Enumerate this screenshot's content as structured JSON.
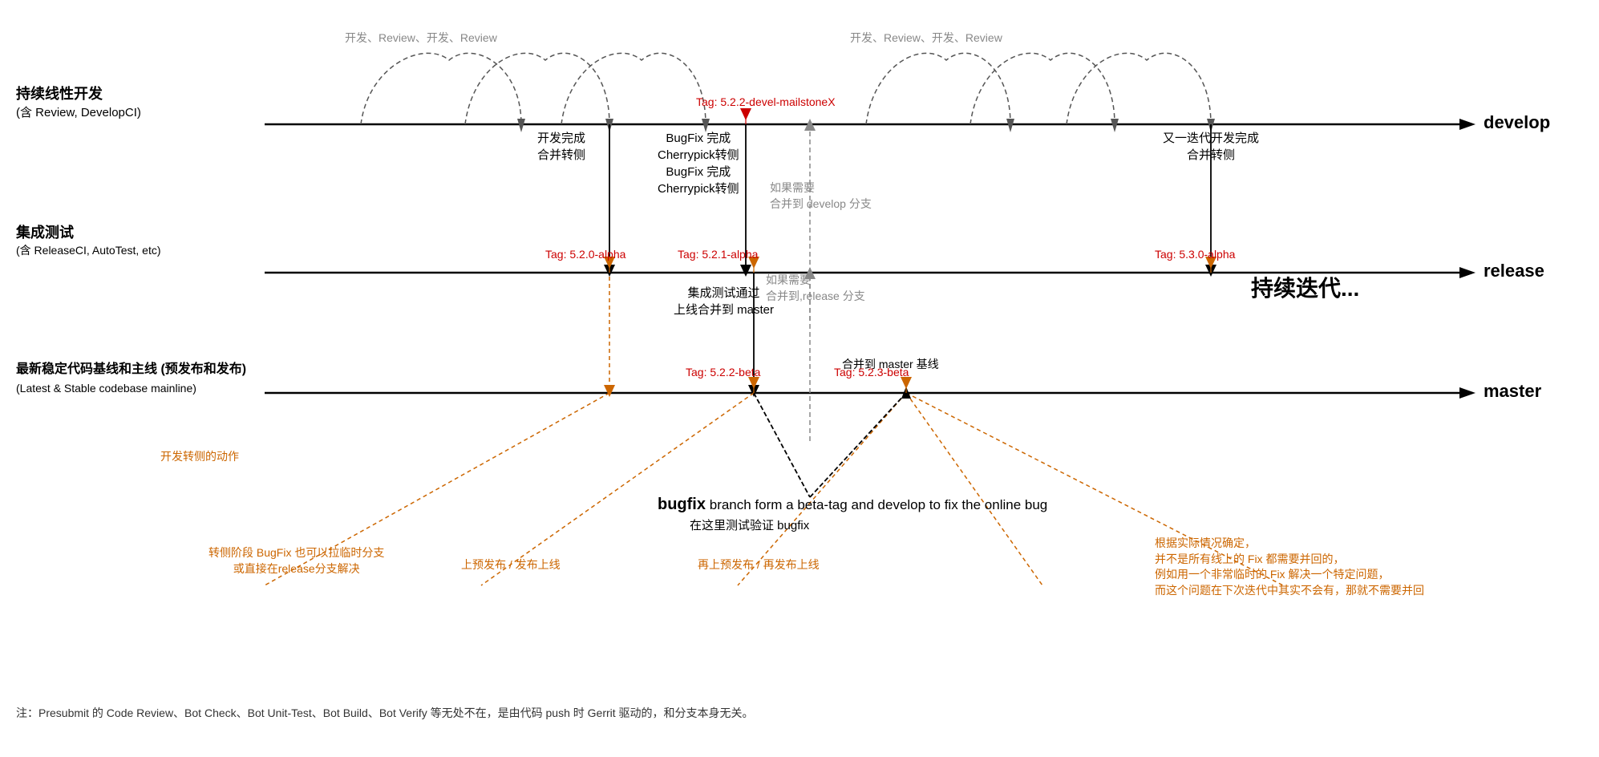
{
  "branches": {
    "develop_label": "develop",
    "release_label": "release",
    "master_label": "master"
  },
  "sidebar_labels": {
    "continuous_dev": "持续线性开发",
    "continuous_dev_sub": "(含 Review, DevelopCI)",
    "integration_test": "集成测试",
    "integration_test_sub": "(含 ReleaseCI, AutoTest, etc)",
    "stable_baseline": "最新稳定代码基线和主线 (预发布和发布)",
    "stable_baseline_sub": "(Latest & Stable codebase mainline)"
  },
  "top_labels": {
    "dev_review_1": "开发、Review、开发、Review",
    "dev_review_2": "开发、Review、开发、Review"
  },
  "events": {
    "e1_title": "开发完成",
    "e1_sub": "合并转侧",
    "e2_title": "BugFix 完成",
    "e2_sub1": "Cherrypick转侧",
    "e2_sub2": "BugFix 完成",
    "e2_sub3": "Cherrypick转侧",
    "e3_title": "又一迭代开发完成",
    "e3_sub": "合并转侧",
    "merge_develop": "合并到 develop 分支",
    "if_needed_1": "如果需要",
    "if_needed_2": "如果需要",
    "merge_release": "合并到,release 分支",
    "merge_master": "合并到 master 基线",
    "integration_pass": "集成测试通过",
    "online_merge": "上线合并到 master",
    "continuous_iter": "持续迭代..."
  },
  "tags": {
    "tag_alpha_520": "Tag: 5.2.0-alpha",
    "tag_alpha_521": "Tag: 5.2.1-alpha",
    "tag_alpha_530": "Tag: 5.3.0-alpha",
    "tag_devel_mailstone": "Tag: 5.2.2-devel-mailstoneX",
    "tag_beta_522": "Tag: 5.2.2-beta",
    "tag_beta_523": "Tag: 5.2.3-beta"
  },
  "bugfix": {
    "title": "bugfix",
    "desc1": "branch form a beta-tag and develop to fix the online bug",
    "desc2": "在这里测试验证 bugfix"
  },
  "orange_labels": {
    "dev_side_action": "开发转侧的动作",
    "bugfix_branch": "转侧阶段 BugFix 也可以拉临时分支",
    "bugfix_branch2": "或直接在release分支解决",
    "pre_release": "上预发布 / 发布上线",
    "re_release": "再上预发布 / 再发布上线",
    "note_right1": "根据实际情况确定，",
    "note_right2": "并不是所有线上的 Fix 都需要并回的，",
    "note_right3": "例如用一个非常临时的 Fix 解决一个特定问题，",
    "note_right4": "而这个问题在下次迭代中其实不会有，那就不需要并回"
  },
  "footer_note": "注：Presubmit 的 Code Review、Bot Check、Bot Unit-Test、Bot Build、Bot Verify 等无处不在，是由代码 push 时 Gerrit 驱动的，和分支本身无关。"
}
